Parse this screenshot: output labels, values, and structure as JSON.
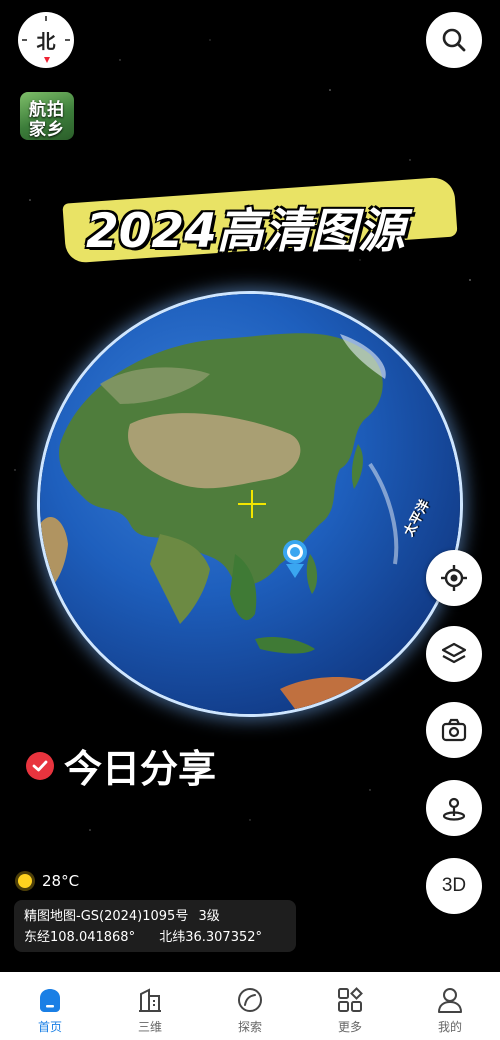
{
  "compass": {
    "label": "北",
    "icon": "compass-icon"
  },
  "logo": {
    "line1": "航拍",
    "line2": "家乡"
  },
  "headline": "2024高清图源",
  "globe": {
    "ocean_label": "太平洋"
  },
  "todays_share": "今日分享",
  "weather": {
    "temperature": "28°C",
    "icon": "sun-icon"
  },
  "map_info": {
    "approval": "精图地图-GS(2024)1095号",
    "level": "3级",
    "longitude": "东经108.041868°",
    "latitude": "北纬36.307352°"
  },
  "right_buttons": [
    {
      "name": "locate",
      "icon": "crosshair-icon"
    },
    {
      "name": "layers",
      "icon": "layers-icon"
    },
    {
      "name": "camera",
      "icon": "camera-icon"
    },
    {
      "name": "place",
      "icon": "map-pin-icon"
    },
    {
      "name": "3d",
      "label": "3D"
    }
  ],
  "tabs": [
    {
      "label": "首页",
      "icon": "home-icon",
      "active": true
    },
    {
      "label": "三维",
      "icon": "buildings-icon",
      "active": false
    },
    {
      "label": "探索",
      "icon": "explore-icon",
      "active": false
    },
    {
      "label": "更多",
      "icon": "grid-icon",
      "active": false
    },
    {
      "label": "我的",
      "icon": "user-icon",
      "active": false
    }
  ],
  "colors": {
    "accent": "#1a7fe5",
    "check": "#e8343e",
    "highlight": "#f6ef6a"
  }
}
